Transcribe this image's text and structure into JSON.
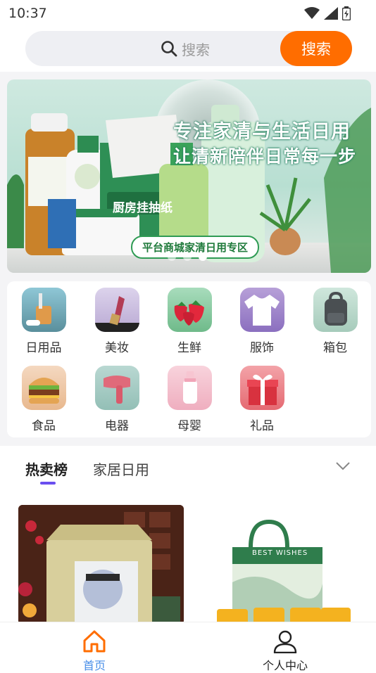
{
  "status_bar": {
    "time": "10:37"
  },
  "search": {
    "placeholder": "搜索",
    "button_label": "搜索"
  },
  "banner": {
    "headline": "专注家清与生活日用",
    "subheadline": "让清新陪伴日常每一步",
    "tag": "平台商城家清日用专区",
    "product_label": "厨房挂抽纸",
    "slides_total": 3,
    "active_slide": 3
  },
  "categories": [
    {
      "label": "日用品",
      "icon": "toothbrush-cup-icon"
    },
    {
      "label": "美妆",
      "icon": "lipstick-icon"
    },
    {
      "label": "生鲜",
      "icon": "strawberry-icon"
    },
    {
      "label": "服饰",
      "icon": "tshirt-icon"
    },
    {
      "label": "箱包",
      "icon": "backpack-icon"
    },
    {
      "label": "食品",
      "icon": "burger-icon"
    },
    {
      "label": "电器",
      "icon": "hair-dryer-icon"
    },
    {
      "label": "母婴",
      "icon": "baby-bottle-icon"
    },
    {
      "label": "礼品",
      "icon": "gift-box-icon"
    }
  ],
  "tabs": [
    {
      "label": "热卖榜",
      "active": true
    },
    {
      "label": "家居日用",
      "active": false
    }
  ],
  "products": [
    {
      "name": "gift-box-product",
      "packaging_text": "BEST WISHES"
    }
  ],
  "bottom_nav": [
    {
      "label": "首页",
      "icon": "home-icon",
      "active": true
    },
    {
      "label": "个人中心",
      "icon": "user-icon",
      "active": false
    }
  ],
  "colors": {
    "accent": "#ff6d00",
    "nav_active": "#4a8fe8",
    "tab_indicator": "#6a4ff0"
  }
}
